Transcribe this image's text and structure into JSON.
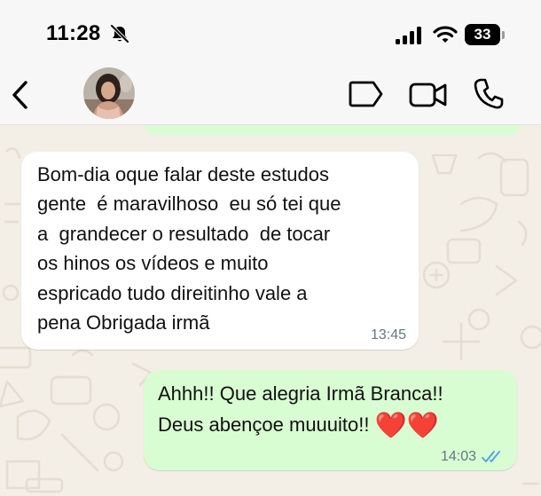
{
  "status_bar": {
    "time": "11:28",
    "battery": "33"
  },
  "contact": {
    "avatar_alt": "contact avatar"
  },
  "messages": [
    {
      "direction": "incoming",
      "lines": [
        "Bom-dia oque falar deste estudos",
        "gente  é maravilhoso  eu só tei que",
        "a  grandecer o resultado  de tocar",
        "os hinos os vídeos e muito",
        "espricado tudo direitinho vale a",
        "pena Obrigada irmã"
      ],
      "time": "13:45"
    },
    {
      "direction": "outgoing",
      "line1": "Ahhh!! Que alegria Irmã Branca!!",
      "line2": "Deus abençoe muuuito!! ",
      "emoji": "❤️❤️",
      "time": "14:03",
      "status": "read"
    }
  ],
  "colors": {
    "outgoing_bubble": "#d9fdd3",
    "incoming_bubble": "#ffffff",
    "read_ticks": "#4fa3e0",
    "wallpaper": "#f3eee6"
  }
}
